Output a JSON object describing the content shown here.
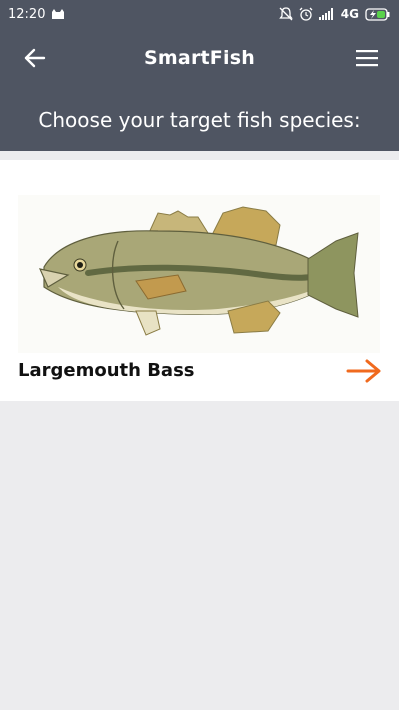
{
  "status_bar": {
    "time": "12:20",
    "network": "4G",
    "icons": [
      "cat-notification-icon",
      "bell-off-icon",
      "alarm-icon",
      "signal-icon",
      "battery-charging-icon"
    ]
  },
  "app_bar": {
    "title": "SmartFish",
    "back_icon": "arrow-left-icon",
    "menu_icon": "hamburger-menu-icon"
  },
  "subheader": {
    "text": "Choose your target fish species:"
  },
  "species_list": [
    {
      "name": "Largemouth Bass",
      "image": "largemouth-bass-illustration",
      "action_icon": "arrow-right-icon",
      "accent": "#f06a1e"
    }
  ],
  "colors": {
    "header": "#4f5562",
    "background": "#ececee",
    "card": "#ffffff",
    "accent": "#f06a1e"
  }
}
